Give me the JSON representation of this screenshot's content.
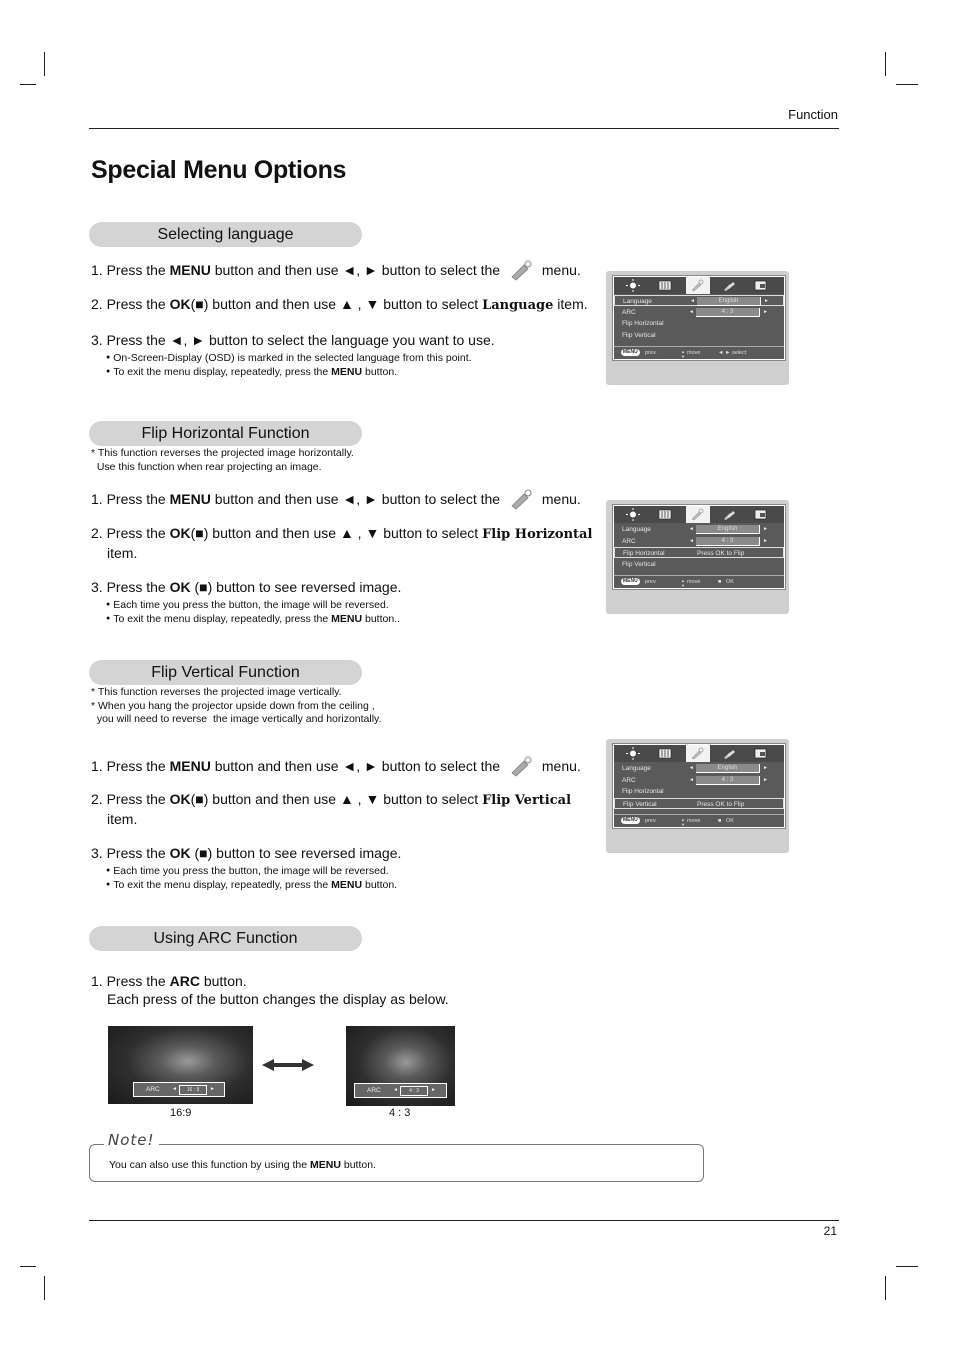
{
  "header": {
    "section": "Function"
  },
  "page_title": "Special Menu Options",
  "page_number": "21",
  "sections": {
    "language": {
      "title": "Selecting language",
      "step1": {
        "num": "1.",
        "pre": "Press the",
        "b1": "MENU",
        "mid": "button and then use ◄, ► button to select the",
        "post": "menu."
      },
      "step2": {
        "num": "2.",
        "pre": "Press the",
        "b1": "OK",
        "mid": "(■) button and then use ▲ , ▼ button to select",
        "item": "Language",
        "post": "item."
      },
      "step3": {
        "num": "3.",
        "text": "Press the ◄, ► button to select the language you want to use."
      },
      "bullets": [
        "On-Screen-Display (OSD) is marked in the selected language from this point.",
        {
          "pre": "To exit the menu display, repeatedly, press the",
          "bold": "MENU",
          "post": "button."
        }
      ]
    },
    "flip_h": {
      "title": "Flip Horizontal Function",
      "notes": "* This function reverses the projected image horizontally.\n  Use this function when rear projecting an image.",
      "step1": {
        "num": "1.",
        "pre": "Press the",
        "b1": "MENU",
        "mid": "button and then use ◄, ► button to select the",
        "post": "menu."
      },
      "step2": {
        "num": "2.",
        "pre": "Press the",
        "b1": "OK",
        "mid": "(■) button and then use ▲ , ▼ button to select",
        "item": "Flip Horizontal",
        "post": "item."
      },
      "step3": {
        "num": "3.",
        "pre": "Press the",
        "b1": "OK",
        "post": "(■) button to see reversed image."
      },
      "bullets": [
        "Each time you press the button, the image will be reversed.",
        {
          "pre": "To exit the menu display, repeatedly, press the",
          "bold": "MENU",
          "post": "button.."
        }
      ]
    },
    "flip_v": {
      "title": "Flip Vertical Function",
      "notes": "* This function reverses the projected image vertically.\n* When you hang the projector upside down from the ceiling ,\n  you will need to reverse  the image vertically and horizontally.",
      "step1": {
        "num": "1.",
        "pre": "Press the",
        "b1": "MENU",
        "mid": "button and then use ◄, ► button to select the",
        "post": "menu."
      },
      "step2": {
        "num": "2.",
        "pre": "Press the",
        "b1": "OK",
        "mid": "(■) button and then use ▲ , ▼ button to select",
        "item": "Flip Vertical",
        "post": "item."
      },
      "step3": {
        "num": "3.",
        "pre": "Press the",
        "b1": "OK",
        "post": "(■) button to see reversed image."
      },
      "bullets": [
        "Each time you press the button, the image will be reversed.",
        {
          "pre": "To exit the menu display, repeatedly, press the",
          "bold": "MENU",
          "post": "button."
        }
      ]
    },
    "arc": {
      "title": "Using ARC Function",
      "step1": {
        "num": "1.",
        "pre": "Press the",
        "b1": "ARC",
        "post": "button.",
        "line2": "Each press of the button changes the display as below."
      },
      "images": [
        {
          "label": "ARC",
          "value": "16 : 9",
          "caption": "16:9"
        },
        {
          "label": "ARC",
          "value": "4 : 3",
          "caption": "4 : 3"
        }
      ]
    }
  },
  "osd_panels": [
    {
      "rows": [
        {
          "label": "Language",
          "value": "English",
          "selected": true
        },
        {
          "label": "ARC",
          "value": "4 : 3"
        },
        {
          "label": "Flip Horizontal"
        },
        {
          "label": "Flip Vertical"
        }
      ],
      "footer": {
        "menu": "MENU",
        "prev": "prev.",
        "move": "move",
        "action_icon": "◄ ►",
        "action": "select"
      }
    },
    {
      "rows": [
        {
          "label": "Language",
          "value": "English"
        },
        {
          "label": "ARC",
          "value": "4 : 3"
        },
        {
          "label": "Flip Horizontal",
          "message": "Press OK to Flip",
          "selected": true
        },
        {
          "label": "Flip Vertical"
        }
      ],
      "footer": {
        "menu": "MENU",
        "prev": "prev.",
        "move": "move",
        "action_icon": "■",
        "action": "OK"
      }
    },
    {
      "rows": [
        {
          "label": "Language",
          "value": "English"
        },
        {
          "label": "ARC",
          "value": "4 : 3"
        },
        {
          "label": "Flip Horizontal"
        },
        {
          "label": "Flip Vertical",
          "message": "Press OK to Flip",
          "selected": true
        }
      ],
      "footer": {
        "menu": "MENU",
        "prev": "prev.",
        "move": "move",
        "action_icon": "■",
        "action": "OK"
      }
    }
  ],
  "osd_tabs": [
    "picture-icon",
    "screen-icon",
    "special-icon",
    "options-icon",
    "input-icon"
  ],
  "note": {
    "title": "Note!",
    "pre": "You can also use this function by using the",
    "bold": "MENU",
    "post": "button."
  }
}
